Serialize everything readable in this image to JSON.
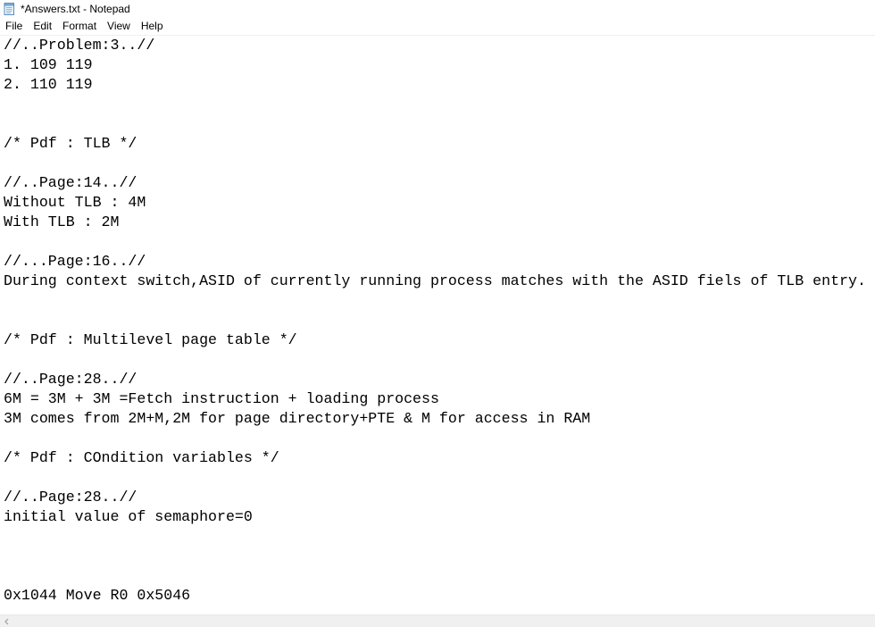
{
  "window": {
    "title": "*Answers.txt - Notepad"
  },
  "menubar": {
    "items": [
      "File",
      "Edit",
      "Format",
      "View",
      "Help"
    ]
  },
  "editor": {
    "lines": [
      "//..Problem:3..//",
      "1. 109 119",
      "2. 110 119",
      "",
      "",
      "/* Pdf : TLB */",
      "",
      "//..Page:14..//",
      "Without TLB : 4M",
      "With TLB : 2M",
      "",
      "//...Page:16..//",
      "During context switch,ASID of currently running process matches with the ASID fiels of TLB entry.",
      "",
      "",
      "/* Pdf : Multilevel page table */",
      "",
      "//..Page:28..//",
      "6M = 3M + 3M =Fetch instruction + loading process",
      "3M comes from 2M+M,2M for page directory+PTE & M for access in RAM",
      "",
      "/* Pdf : COndition variables */",
      "",
      "//..Page:28..//",
      "initial value of semaphore=0",
      "",
      "",
      "",
      "0x1044 Move R0 0x5046"
    ]
  },
  "icons": {
    "app": "notepad-icon",
    "scroll_left": "scroll-left-arrow-icon"
  }
}
